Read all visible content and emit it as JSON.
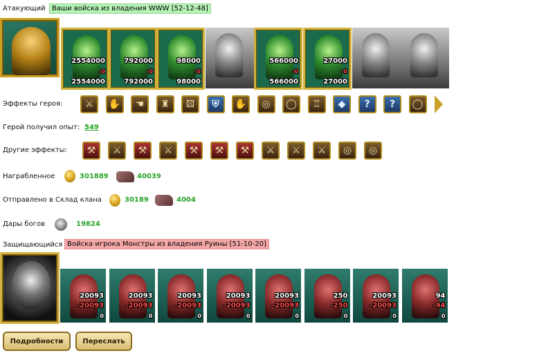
{
  "attacker": {
    "label": "Атакующий",
    "tag": "Ваши войска из владения WWW [52-12-48]",
    "units": [
      {
        "top": "2554000",
        "delta": "-0",
        "bottom": "2554000",
        "style": "framed"
      },
      {
        "top": "792000",
        "delta": "-0",
        "bottom": "792000",
        "style": "framed"
      },
      {
        "top": "98000",
        "delta": "-0",
        "bottom": "98000",
        "style": "framed"
      },
      {
        "top": "",
        "delta": "",
        "bottom": "",
        "style": "gray"
      },
      {
        "top": "566000",
        "delta": "-0",
        "bottom": "566000",
        "style": "framed"
      },
      {
        "top": "27000",
        "delta": "-0",
        "bottom": "27000",
        "style": "framed"
      },
      {
        "top": "",
        "delta": "",
        "bottom": "",
        "style": "gray"
      },
      {
        "top": "",
        "delta": "",
        "bottom": "",
        "style": "gray"
      }
    ]
  },
  "hero_effects": {
    "label": "Эффекты героя:",
    "icons": [
      "sword-icon",
      "handshake-icon",
      "hand-icon",
      "castle-icon",
      "dice-icon",
      "shield-icon",
      "handshake-icon",
      "coins-icon",
      "ring-icon",
      "armor-icon",
      "crystal-icon",
      "question-icon",
      "question-icon",
      "bracelet-icon"
    ]
  },
  "experience": {
    "label": "Герой получил опыт:",
    "value": "549"
  },
  "other_effects": {
    "label": "Другие эффекты:",
    "icons": [
      "axe-icon",
      "sword-icon",
      "axe-icon",
      "sword-icon",
      "axe-icon",
      "axe-icon",
      "axe-icon",
      "sword-icon",
      "sword-icon",
      "sword-icon",
      "coins-icon",
      "coins-icon"
    ]
  },
  "loot": {
    "label": "Награбленное",
    "gold": "301889",
    "ore": "40039"
  },
  "clan_storage": {
    "label": "Отправлено в Склад клана",
    "gold": "30189",
    "ore": "4004"
  },
  "gods_gifts": {
    "label": "Дары богов",
    "value": "19824"
  },
  "defender": {
    "label": "Защищающийся",
    "tag": "Войска игрока Монстры из владения Руины [51-10-20]",
    "units": [
      {
        "top": "20093",
        "delta": "-20093",
        "bottom": "0"
      },
      {
        "top": "20093",
        "delta": "-20093",
        "bottom": "0"
      },
      {
        "top": "20093",
        "delta": "-20093",
        "bottom": "0"
      },
      {
        "top": "20093",
        "delta": "-20093",
        "bottom": "0"
      },
      {
        "top": "20093",
        "delta": "-20093",
        "bottom": "0"
      },
      {
        "top": "250",
        "delta": "-250",
        "bottom": "0"
      },
      {
        "top": "20093",
        "delta": "-20093",
        "bottom": "0"
      },
      {
        "top": "94",
        "delta": "-94",
        "bottom": "0"
      }
    ]
  },
  "buttons": {
    "details": "Подробности",
    "forward": "Переслать"
  }
}
